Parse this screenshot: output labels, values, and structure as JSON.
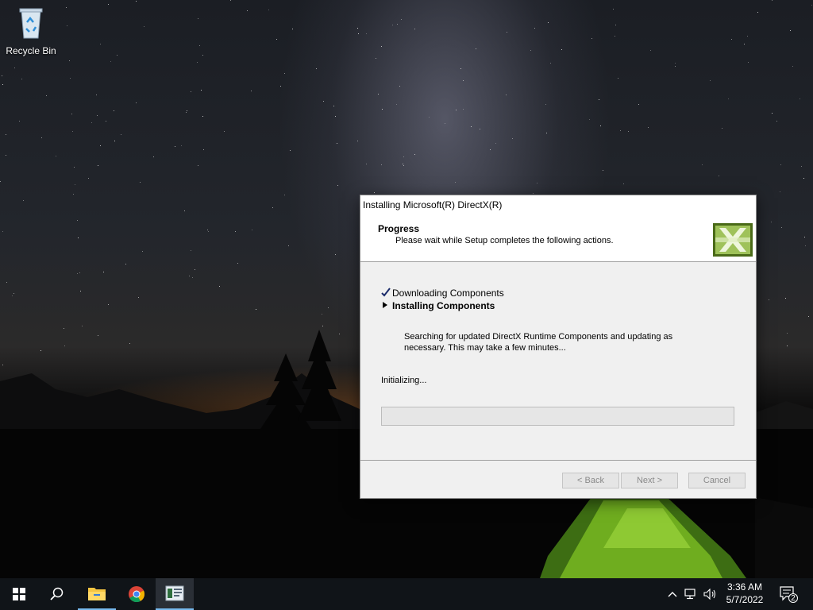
{
  "desktop": {
    "icons": [
      {
        "label": "Recycle Bin",
        "icon": "recycle-bin-icon"
      }
    ]
  },
  "dialog": {
    "title": "Installing Microsoft(R) DirectX(R)",
    "header_title": "Progress",
    "header_subtitle": "Please wait while Setup completes the following actions.",
    "logo_icon": "directx-logo-icon",
    "steps": [
      {
        "label": "Downloading Components",
        "state": "done",
        "icon": "checkmark-icon"
      },
      {
        "label": "Installing Components",
        "state": "current",
        "icon": "arrow-right-icon"
      }
    ],
    "description": "Searching for updated DirectX Runtime Components and updating as necessary. This may take a few minutes...",
    "status": "Initializing...",
    "progress_percent": 0,
    "buttons": {
      "back": "< Back",
      "next": "Next >",
      "cancel": "Cancel"
    }
  },
  "taskbar": {
    "items": [
      {
        "name": "start",
        "icon": "windows-start-icon"
      },
      {
        "name": "search",
        "icon": "search-icon"
      },
      {
        "name": "file-explorer",
        "icon": "folder-icon"
      },
      {
        "name": "chrome",
        "icon": "chrome-icon"
      },
      {
        "name": "directx-setup",
        "icon": "setup-window-icon",
        "active": true
      }
    ],
    "tray": {
      "icons": [
        "chevron-up-icon",
        "network-icon",
        "volume-icon"
      ],
      "time": "3:36 AM",
      "date": "5/7/2022",
      "notification_count": "2"
    }
  },
  "colors": {
    "accent": "#76b9ed",
    "taskbar": "#101418",
    "dialog_bg": "#f0f0f0",
    "progress_fill": "#06b025"
  }
}
